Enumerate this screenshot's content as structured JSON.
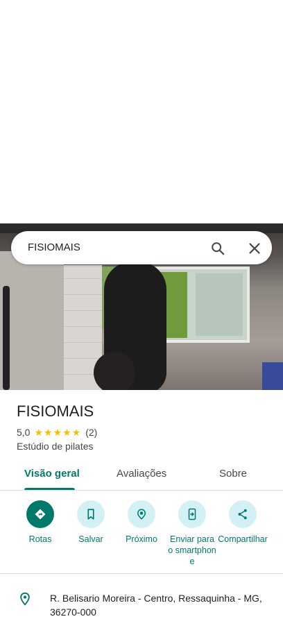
{
  "search": {
    "query": "FISIOMAIS"
  },
  "place": {
    "name": "FISIOMAIS",
    "rating": "5,0",
    "stars": "★★★★★",
    "review_count": "(2)",
    "category": "Estúdio de pilates"
  },
  "tabs": [
    {
      "label": "Visão geral",
      "active": true
    },
    {
      "label": "Avaliações"
    },
    {
      "label": "Sobre"
    }
  ],
  "actions": [
    {
      "label": "Rotas",
      "icon": "directions-icon"
    },
    {
      "label": "Salvar",
      "icon": "bookmark-icon"
    },
    {
      "label": "Próximo",
      "icon": "nearby-icon"
    },
    {
      "label": "Enviar para o smartphone",
      "icon": "send-to-phone-icon"
    },
    {
      "label": "Compartilhar",
      "icon": "share-icon"
    }
  ],
  "address": {
    "text": "R. Belisario Moreira - Centro, Ressaquinha - MG, 36270-000"
  },
  "colors": {
    "accent": "#00796b",
    "action_bg": "#d3f1f5",
    "star": "#fbbc04"
  }
}
